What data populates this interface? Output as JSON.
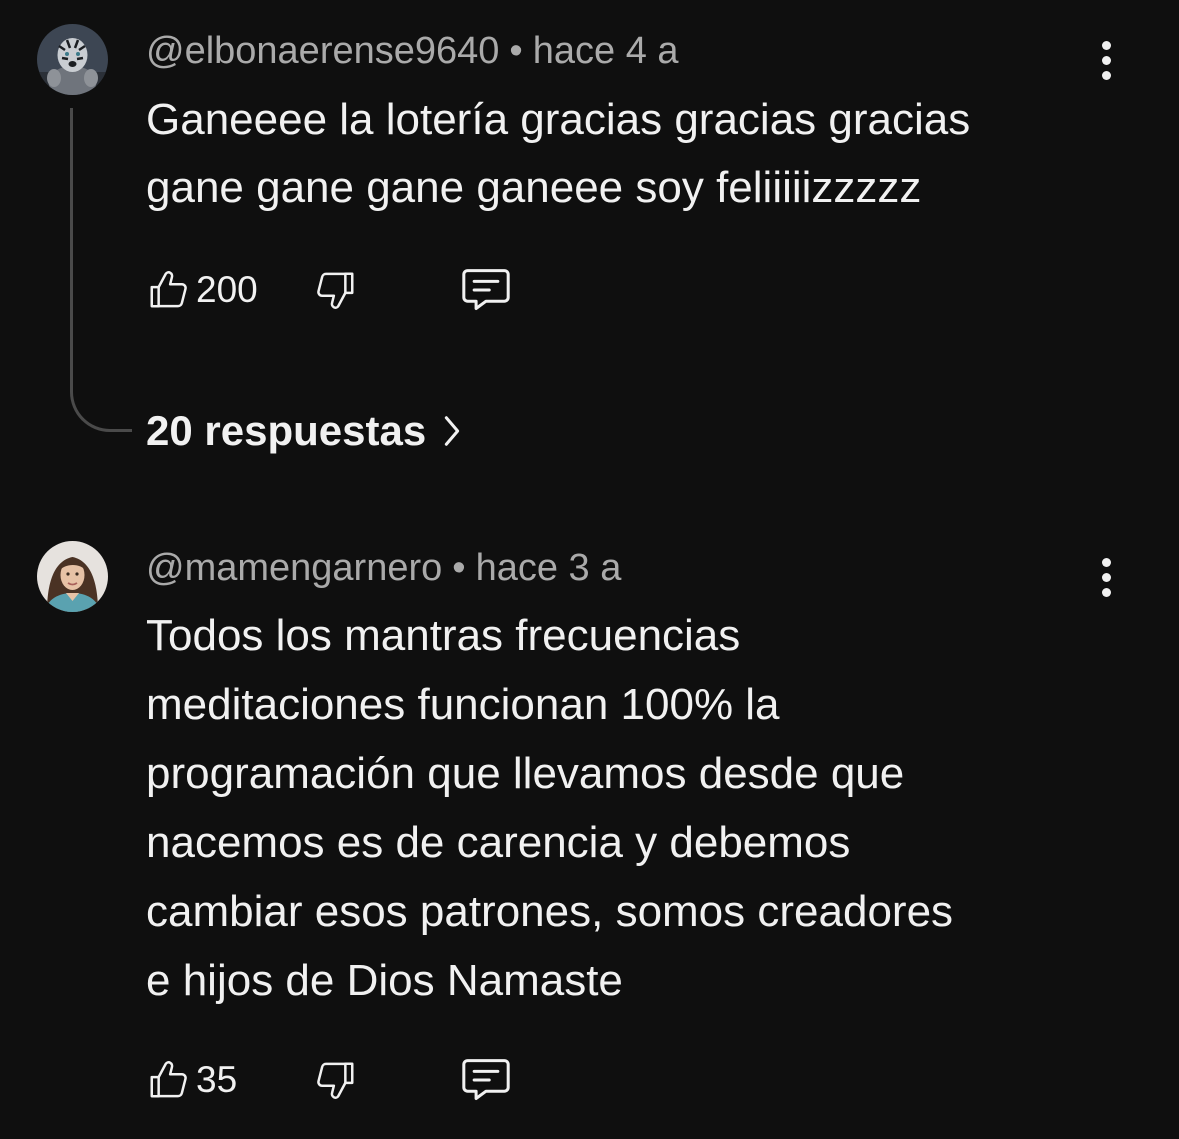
{
  "comments": [
    {
      "author": "@elbonaerense9640",
      "separator": "•",
      "time": "hace 4 a",
      "text": "Ganeeee la lotería gracias gracias gracias\ngane gane gane ganeee soy feliiiiizzzzz",
      "likes": "200",
      "replies_label": "20 respuestas"
    },
    {
      "author": "@mamengarnero",
      "separator": "•",
      "time": "hace 3 a",
      "text": "Todos los mantras frecuencias\nmeditaciones funcionan 100% la\nprogramación  que llevamos desde que\nnacemos es de carencia y debemos\ncambiar esos patrones,  somos creadores\ne hijos de Dios Namaste",
      "likes": "35"
    }
  ],
  "icons": {
    "like": "thumbs-up-icon",
    "dislike": "thumbs-down-icon",
    "reply": "comment-icon",
    "menu": "more-vertical-icon",
    "replies_chevron": "chevron-right-icon"
  },
  "colors": {
    "background": "#0f0f0f",
    "text_primary": "#f1f1f1",
    "text_secondary": "#aaaaaa"
  }
}
